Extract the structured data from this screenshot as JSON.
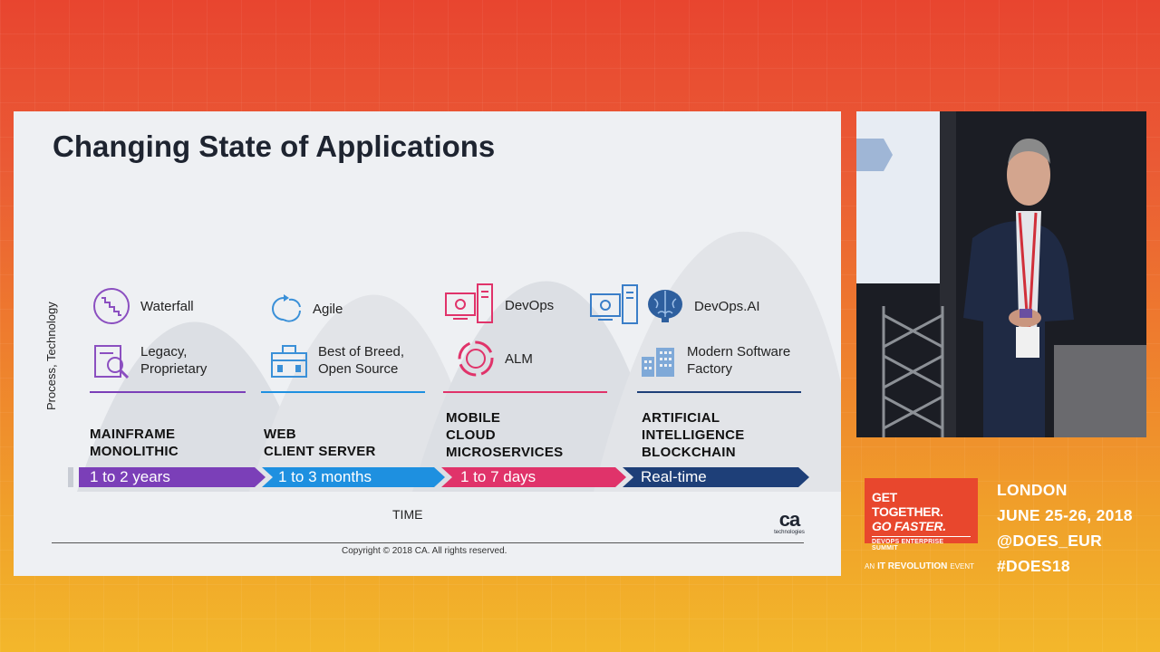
{
  "slide": {
    "title": "Changing State of Applications",
    "y_axis_label": "Process, Technology",
    "x_axis_label": "TIME",
    "copyright": "Copyright © 2018 CA. All rights reserved.",
    "logo": {
      "mark": "ca",
      "sub": "technologies"
    },
    "columns": [
      {
        "items": [
          {
            "label": "Waterfall",
            "icon": "waterfall-icon"
          },
          {
            "label": "Legacy, Proprietary",
            "icon": "legacy-icon"
          }
        ],
        "era": [
          "MAINFRAME",
          "MONOLITHIC"
        ],
        "duration": "1 to 2 years",
        "color": "#7b3fb8"
      },
      {
        "items": [
          {
            "label": "Agile",
            "icon": "agile-cycle-icon"
          },
          {
            "label": "Best of Breed, Open Source",
            "icon": "toolbox-icon"
          }
        ],
        "era": [
          "WEB",
          "CLIENT SERVER"
        ],
        "duration": "1 to 3 months",
        "color": "#1e90e0"
      },
      {
        "items": [
          {
            "label": "DevOps",
            "icon": "devops-computer-icon"
          },
          {
            "label": "ALM",
            "icon": "alm-cycle-icon"
          }
        ],
        "era": [
          "MOBILE",
          "CLOUD",
          "MICROSERVICES"
        ],
        "duration": "1 to 7 days",
        "color": "#e0336a"
      },
      {
        "items": [
          {
            "label": "DevOps.AI",
            "icon": "brain-icon"
          },
          {
            "label": "Modern Software Factory",
            "icon": "factory-icon"
          }
        ],
        "era": [
          "ARTIFICIAL",
          "INTELLIGENCE",
          "BLOCKCHAIN"
        ],
        "duration": "Real-time",
        "color": "#1e3f78"
      }
    ]
  },
  "event": {
    "logo_line1": "GET TOGETHER.",
    "logo_line2": "GO FASTER.",
    "logo_line3": "DEVOPS ENTERPRISE SUMMIT",
    "an_prefix": "AN",
    "an_brand": "IT REVOLUTION",
    "an_suffix": "EVENT",
    "city": "LONDON",
    "dates": "JUNE 25-26, 2018",
    "handle": "@DOES_EUR",
    "hashtag": "#DOES18",
    "accent": "#e8472d"
  }
}
